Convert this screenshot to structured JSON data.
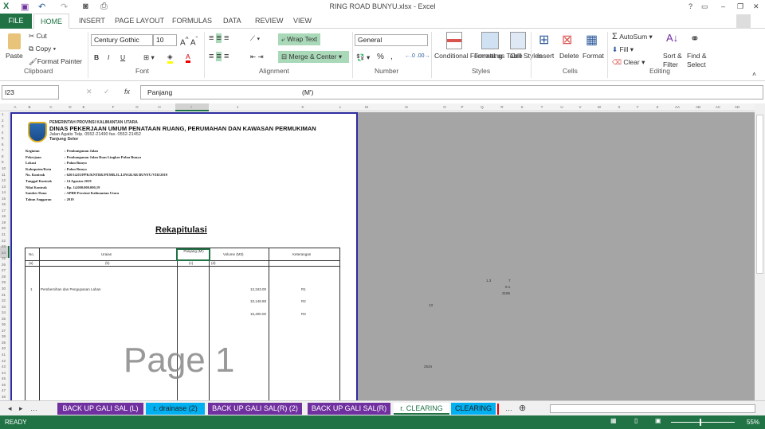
{
  "window": {
    "title": "RING ROAD BUNYU.xlsx - Excel",
    "help": "?",
    "minimize": "–",
    "restore": "❐",
    "close": "✕"
  },
  "ribbon_tabs": [
    "FILE",
    "HOME",
    "INSERT",
    "PAGE LAYOUT",
    "FORMULAS",
    "DATA",
    "REVIEW",
    "VIEW"
  ],
  "clipboard": {
    "paste": "Paste",
    "cut": "Cut",
    "copy": "Copy",
    "format_painter": "Format Painter",
    "label": "Clipboard"
  },
  "font": {
    "name": "Century Gothic",
    "size": "10",
    "bold": "B",
    "italic": "I",
    "underline": "U",
    "label": "Font"
  },
  "alignment": {
    "wrap": "Wrap Text",
    "merge": "Merge & Center",
    "label": "Alignment"
  },
  "number": {
    "format": "General",
    "percent": "%",
    "comma": ",",
    "label": "Number"
  },
  "styles": {
    "conditional": "Conditional Formatting",
    "format_table": "Format as Table",
    "cell_styles": "Cell Styles",
    "label": "Styles"
  },
  "cells": {
    "insert": "Insert",
    "delete": "Delete",
    "format": "Format",
    "label": "Cells"
  },
  "editing": {
    "autosum": "AutoSum",
    "fill": "Fill",
    "clear": "Clear",
    "sort": "Sort & Filter",
    "find": "Find & Select",
    "label": "Editing"
  },
  "formula_bar": {
    "name_box": "I23",
    "fx": "fx",
    "value": "Panjang",
    "value2": "(M')"
  },
  "columns": [
    "A",
    "B",
    "C",
    "D",
    "E",
    "F",
    "G",
    "H",
    "I",
    "J",
    "K",
    "L",
    "M",
    "N",
    "O",
    "P",
    "Q",
    "R",
    "S",
    "T",
    "U",
    "V",
    "W",
    "X",
    "Y",
    "Z",
    "AA",
    "AB",
    "AC",
    "AD"
  ],
  "doc": {
    "org1": "PEMERINTAH PROVINSI KALIMANTAN UTARA",
    "org2": "DINAS  PEKERJAAN UMUM PENATAAN RUANG, PERUMAHAN DAN KAWASAN PERMUKIMAN",
    "org3": "Jalan Agatis Telp. 0552-21490 fax. 0552-21452",
    "org4": "Tanjung Selor",
    "info": [
      [
        "Kegiatan",
        ": Pembangunan Jalan"
      ],
      [
        "Pekerjaan",
        ": Pembangunan Jalan Ruas Lingkar Pulau Bunyu"
      ],
      [
        "Lokasi",
        ": Pulau Bunyu"
      ],
      [
        "Kabupaten/Kota",
        ": Pulau Bunyu"
      ],
      [
        "No. Kontrak",
        ": 620/14.03/PPK/KNTRK/PEMB.JL.LINGKAR BUNYU/VIII/2019"
      ],
      [
        "Tanggal Kontrak",
        ": 14 Agustus 2019"
      ],
      [
        "Nilai Kontrak",
        ": Rp. 14.000.000.000,19"
      ],
      [
        "Sumber Dana",
        ": APBD Provinsi Kalimantan Utara"
      ],
      [
        "Tahun Anggaran",
        ": 2019"
      ]
    ],
    "heading": "Rekapitulasi",
    "headers": [
      "No.",
      "Uraian",
      "Panjang (M')",
      "Volume  (M3)",
      "Keterangan"
    ],
    "subheaders": [
      "(a)",
      "(b)",
      "(c)",
      "(d)",
      ""
    ],
    "row_no": "1",
    "row_desc": "Pembersihan dan Pengupasan Lahan",
    "volumes": [
      "12,343.00",
      "10,148.88",
      "16,400.00"
    ],
    "notes": [
      "R1",
      "R2",
      "R3"
    ],
    "watermark": "Page 1"
  },
  "stray": [
    "1.3",
    "7",
    "9.1",
    "3185",
    "13",
    "2534"
  ],
  "sheet_tabs": [
    {
      "label": "BACK UP GALI SAL (L)",
      "color": "#7030a0"
    },
    {
      "label": "r. drainase (2)",
      "color": "#00b0f0"
    },
    {
      "label": "BACK UP GALI SAL(R) (2)",
      "color": "#7030a0"
    },
    {
      "label": "BACK UP GALI SAL(R)",
      "color": "#7030a0"
    },
    {
      "label": "r. CLEARING",
      "color": "#ffffff"
    },
    {
      "label": "CLEARING",
      "color": "#00b0f0"
    }
  ],
  "status": {
    "ready": "READY",
    "zoom": "55%"
  }
}
